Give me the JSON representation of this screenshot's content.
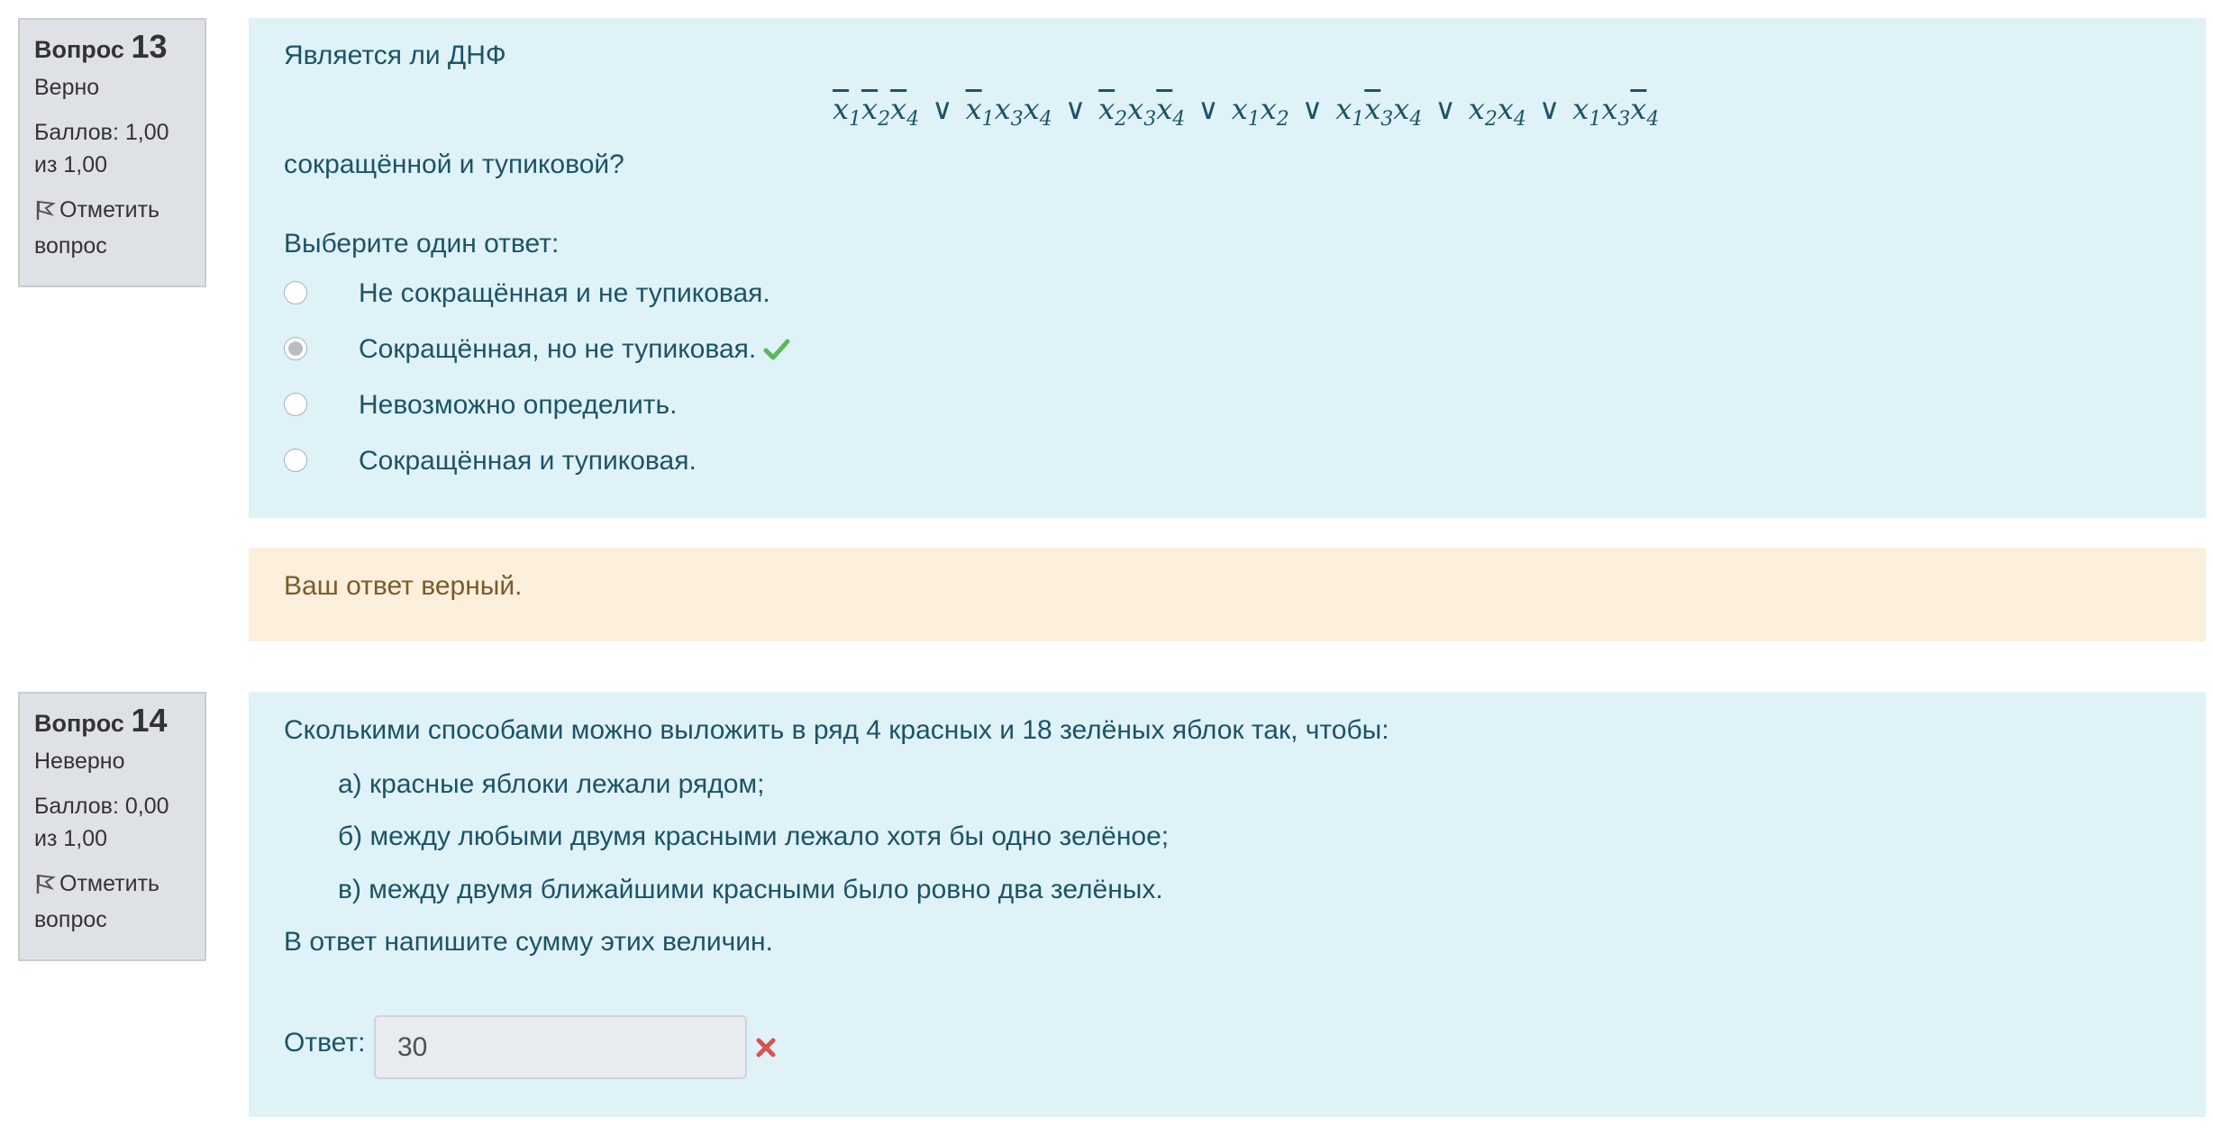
{
  "questions": [
    {
      "label": "Вопрос",
      "number": "13",
      "state": "Верно",
      "grade": "Баллов: 1,00 из 1,00",
      "flag_label": "Отметить вопрос",
      "text_before": "Является ли ДНФ",
      "text_after": "сокращённой и тупиковой?",
      "prompt": "Выберите один ответ:",
      "options": [
        {
          "label": "Не сокращённая и не тупиковая.",
          "selected": false
        },
        {
          "label": "Сокращённая, но не тупиковая.",
          "selected": true,
          "mark": "correct"
        },
        {
          "label": "Невозможно определить.",
          "selected": false
        },
        {
          "label": "Сокращённая и тупиковая.",
          "selected": false
        }
      ],
      "feedback": "Ваш ответ верный."
    },
    {
      "label": "Вопрос",
      "number": "14",
      "state": "Неверно",
      "grade": "Баллов: 0,00 из 1,00",
      "flag_label": "Отметить вопрос",
      "text": "Сколькими способами можно выложить в ряд 4 красных и 18 зелёных яблок так, чтобы:",
      "items": [
        "а) красные яблоки лежали рядом;",
        "б) между любыми двумя красными лежало хотя бы одно зелёное;",
        "в) между двумя ближайшими красными было ровно два зелёных."
      ],
      "text_end": "В ответ напишите сумму этих величин.",
      "answer_label": "Ответ:",
      "answer_value": "30",
      "mark": "incorrect"
    }
  ],
  "colors": {
    "content_bg": "#def2f8",
    "feedback_bg": "#fcefdc",
    "info_bg": "#dee2e6",
    "correct": "#5cb85c",
    "incorrect": "#d9534f"
  },
  "icons": {
    "flag": "flag-icon",
    "correct": "check-icon",
    "incorrect": "cross-icon"
  }
}
